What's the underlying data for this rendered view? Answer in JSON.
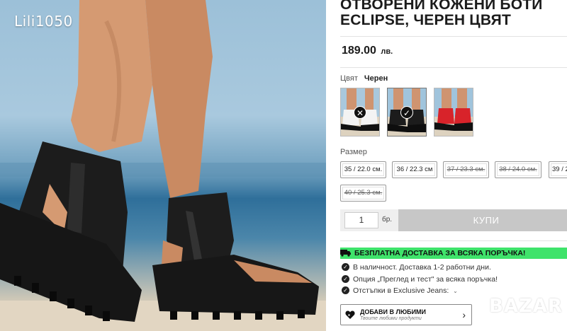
{
  "watermark": "Lili1050",
  "product": {
    "title_line1": "ОТВОРЕНИ КОЖЕНИ БОТИ",
    "title_line2": "ECLIPSE, ЧЕРЕН ЦВЯТ",
    "price": "189.00",
    "currency": "лв."
  },
  "color": {
    "label": "Цвят",
    "selected": "Черен",
    "swatches": [
      {
        "name": "white-black",
        "status": "unavailable",
        "icon": "x-icon"
      },
      {
        "name": "black",
        "status": "selected",
        "icon": "check-icon"
      },
      {
        "name": "red",
        "status": "available",
        "icon": ""
      }
    ]
  },
  "size": {
    "label": "Размер",
    "options": [
      {
        "label": "35 / 22.0 см.",
        "available": true
      },
      {
        "label": "36 / 22.3 см",
        "available": true
      },
      {
        "label": "37 / 23.3 см.",
        "available": false
      },
      {
        "label": "38 / 24.0 см.",
        "available": false
      },
      {
        "label": "39 / 2",
        "available": true
      },
      {
        "label": "40 / 25.3 см.",
        "available": false
      }
    ]
  },
  "cart": {
    "quantity": "1",
    "unit": "бр.",
    "buy_label": "КУПИ"
  },
  "shipping_banner": "БЕЗПЛАТНА ДОСТАВКА ЗА ВСЯКА ПОРЪЧКА!",
  "features": [
    "В наличност. Доставка 1-2 работни дни.",
    "Опция „Преглед и тест\" за всяка поръчка!",
    "Отстъпки в Exclusive Jeans:"
  ],
  "favorites": {
    "label": "ДОБАВИ В ЛЮБИМИ",
    "sublabel": "Твоите любими продукти"
  },
  "brand_watermark": "BAZAR",
  "colors": {
    "shipping_green": "#3fe36b",
    "buy_button": "#c7c7c7",
    "swatch_red": "#d8232a"
  }
}
